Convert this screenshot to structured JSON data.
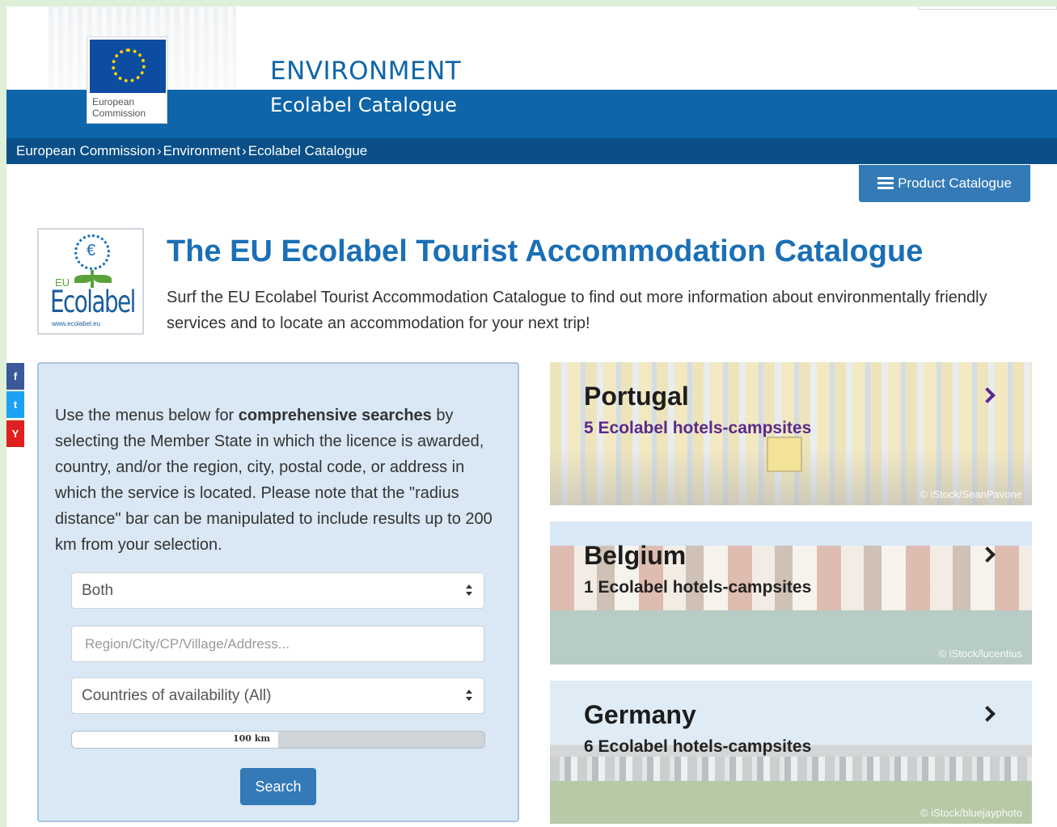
{
  "header": {
    "ec_logo_text": "European Commission",
    "site_title": "ENVIRONMENT",
    "site_subtitle": "Ecolabel Catalogue",
    "breadcrumb": [
      "European Commission",
      "Environment",
      "Ecolabel Catalogue"
    ],
    "breadcrumb_separator": "›"
  },
  "product_catalogue_button": {
    "label": "Product Catalogue",
    "icon": "list-icon"
  },
  "ecolabel_logo": {
    "eu": "EU",
    "word": "Ecolabel",
    "url": "www.ecolabel.eu"
  },
  "main": {
    "title": "The EU Ecolabel Tourist Accommodation Catalogue",
    "intro": "Surf the EU Ecolabel Tourist Accommodation Catalogue to find out more information about environmentally friendly services and to locate an accommodation for your next trip!"
  },
  "social": {
    "facebook": "f",
    "twitter": "t",
    "yammer": "Y"
  },
  "search": {
    "text_before": "Use the menus below for ",
    "text_bold": "comprehensive searches",
    "text_after": " by selecting the Member State in which the licence is awarded, country, and/or the region, city, postal code, or address in which the service is located. Please note that the \"radius distance\" bar can be manipulated to include results up to 200 km from your selection.",
    "type_select_value": "Both",
    "location_placeholder": "Region/City/CP/Village/Address...",
    "countries_select_value": "Countries of availability (All)",
    "radius": {
      "label": "100 km",
      "value_km": 100,
      "max_km": 200
    },
    "search_button": "Search"
  },
  "cards": [
    {
      "country": "Portugal",
      "count_text": "5 Ecolabel hotels-campsites",
      "credit": "© iStock/SeanPavone",
      "highlight": true
    },
    {
      "country": "Belgium",
      "count_text": "1 Ecolabel hotels-campsites",
      "credit": "© iStock/lucentius",
      "highlight": false
    },
    {
      "country": "Germany",
      "count_text": "6 Ecolabel hotels-campsites",
      "credit": "© iStock/bluejayphoto",
      "highlight": false
    }
  ],
  "colors": {
    "brand_blue": "#0e65a9",
    "breadcrumb_blue": "#0a4f88",
    "button_blue": "#337ab7",
    "title_blue": "#1a6fb5",
    "panel_bg": "#d9e8f4",
    "highlight_purple": "#5b2a8a"
  }
}
